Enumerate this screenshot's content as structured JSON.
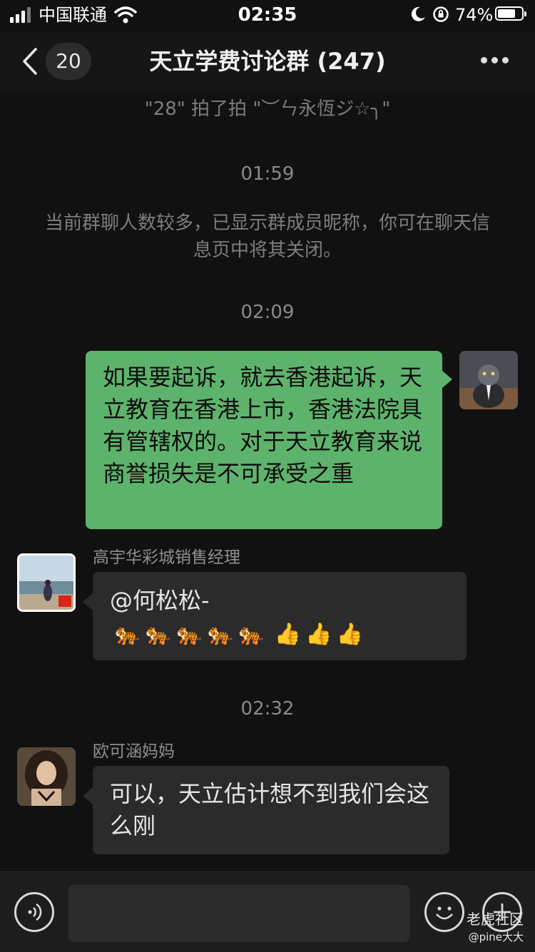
{
  "status_bar": {
    "carrier": "中国联通",
    "time": "02:35",
    "battery": "74%",
    "battery_level": 0.74
  },
  "nav": {
    "unread_count": "20",
    "title": "天立学费讨论群 (247)"
  },
  "chat": {
    "pat_notice": "\"28\" 拍了拍 \"︶ㄣ永恆ジ☆╮\"",
    "timestamp_1": "01:59",
    "system_notice": "当前群聊人数较多，已显示群成员昵称，你可在聊天信息页中将其关闭。",
    "timestamp_2": "02:09",
    "msg_self": "如果要起诉，就去香港起诉，天立教育在香港上市，香港法院具有管辖权的。对于天立教育来说商誉损失是不可承受之重",
    "sender_2": "高宇华彩城销售经理",
    "msg_2_text": "@何松松-",
    "msg_2_emoji": [
      "tiger-emoji",
      "tiger-emoji",
      "tiger-emoji",
      "tiger-emoji",
      "tiger-emoji",
      "thumbs-up-emoji",
      "thumbs-up-emoji",
      "thumbs-up-emoji"
    ],
    "timestamp_3": "02:32",
    "sender_3": "欧可涵妈妈",
    "msg_3": "可以，天立估计想不到我们会这么刚"
  },
  "watermark": {
    "line1": "老虎社区",
    "line2": "@pine大大"
  },
  "colors": {
    "background": "#111111",
    "self_bubble": "#5eb36c",
    "other_bubble": "#2b2b2b"
  }
}
